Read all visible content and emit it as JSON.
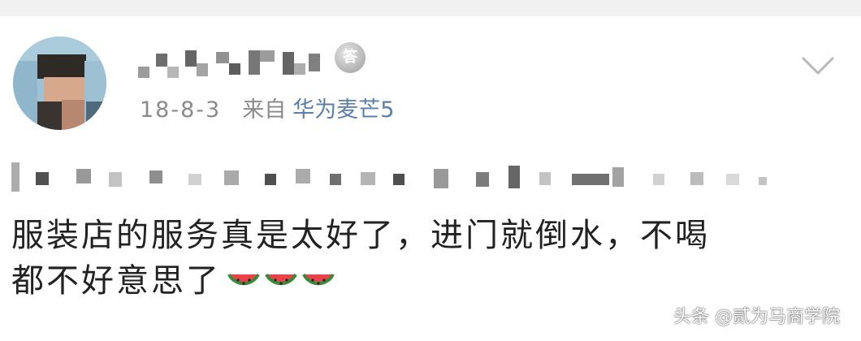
{
  "post": {
    "badge_glyph": "答",
    "date": "18-8-3",
    "from_label": "来自",
    "device": "华为麦芒5",
    "line1": "服装店的服务真是太好了，进门就倒水，不喝",
    "line2": "都不好意思了",
    "emoji_name": "watermelon-emoji",
    "emoji_count": 3
  },
  "watermark": {
    "text": "头条 @贰为马商学院"
  },
  "colors": {
    "meta": "#8a8a8a",
    "device_link": "#5a7fa8",
    "body_text": "#222222",
    "top_bar": "#f1f1f1"
  },
  "icons": {
    "expand": "chevron-down-icon",
    "badge": "answer-badge-icon"
  }
}
